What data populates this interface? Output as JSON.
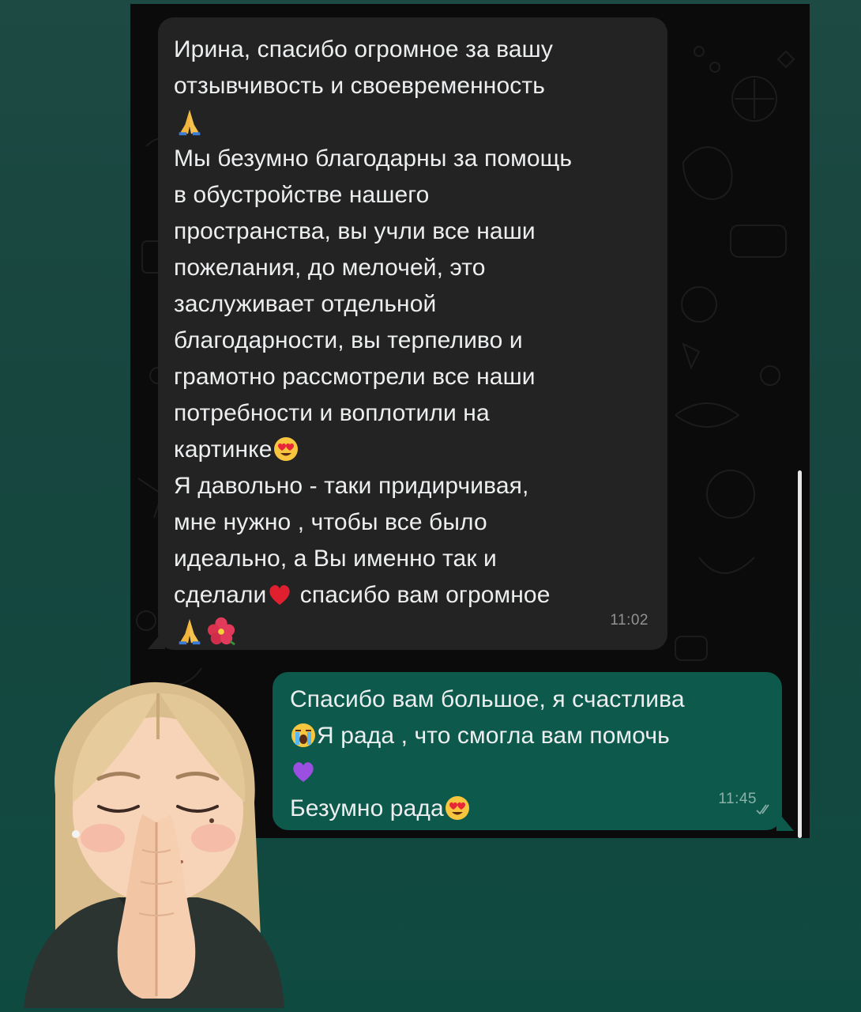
{
  "chat": {
    "incoming": {
      "lines": [
        "Ирина, спасибо огромное за вашу",
        "отзывчивость и своевременность",
        "Мы безумно благодарны за помощь",
        "в обустройстве нашего",
        "пространства, вы учли все наши",
        "пожелания, до мелочей, это",
        "заслуживает отдельной",
        "благодарности, вы терпеливо и",
        "грамотно рассмотрели все наши",
        "потребности и воплотили на",
        "картинке",
        "Я давольно - таки придирчивая,",
        "мне нужно , чтобы все было",
        "идеально, а Вы именно так и",
        "сделали",
        " спасибо вам огромное"
      ],
      "time": "11:02"
    },
    "outgoing": {
      "lines": [
        "Спасибо вам большое, я счастлива",
        "Я рада , что смогла вам помочь",
        "Безумно рада"
      ],
      "time": "11:45"
    }
  },
  "icons": {
    "pray": "folded-hands-emoji",
    "heart_eyes": "heart-eyes-emoji",
    "red_heart": "red-heart-emoji",
    "hibiscus": "hibiscus-emoji",
    "crying": "loudly-crying-emoji",
    "purple_heart": "purple-heart-emoji",
    "read": "double-check-icon"
  },
  "colors": {
    "page_background": "#17463f",
    "incoming_bubble": "#232323",
    "outgoing_bubble": "#0d5a4d",
    "text": "#eceeef"
  }
}
